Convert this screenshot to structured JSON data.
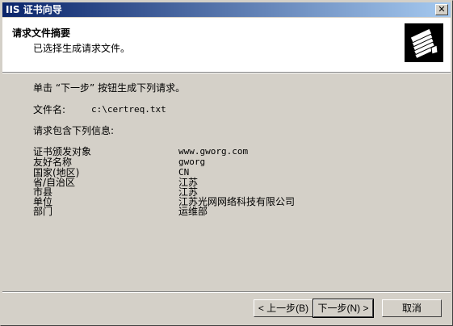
{
  "window": {
    "title": "IIS 证书向导",
    "close_glyph": "✕"
  },
  "header": {
    "title": "请求文件摘要",
    "subtitle": "已选择生成请求文件。",
    "icon": "certificate-icon"
  },
  "main": {
    "instruction": "单击 “下一步” 按钮生成下列请求。",
    "file_label": "文件名:",
    "file_value": "c:\\certreq.txt",
    "info_heading": "请求包含下列信息:",
    "fields": [
      {
        "label": "证书颁发对象",
        "value": "www.gworg.com"
      },
      {
        "label": "友好名称",
        "value": "gworg"
      },
      {
        "label": "国家(地区)",
        "value": "CN"
      },
      {
        "label": "省/自治区",
        "value": "江苏"
      },
      {
        "label": "市县",
        "value": "江苏"
      },
      {
        "label": "单位",
        "value": "江苏光网网络科技有限公司"
      },
      {
        "label": "部门",
        "value": "运维部"
      }
    ]
  },
  "buttons": {
    "back": "< 上一步(B)",
    "next": "下一步(N) >",
    "cancel": "取消"
  }
}
